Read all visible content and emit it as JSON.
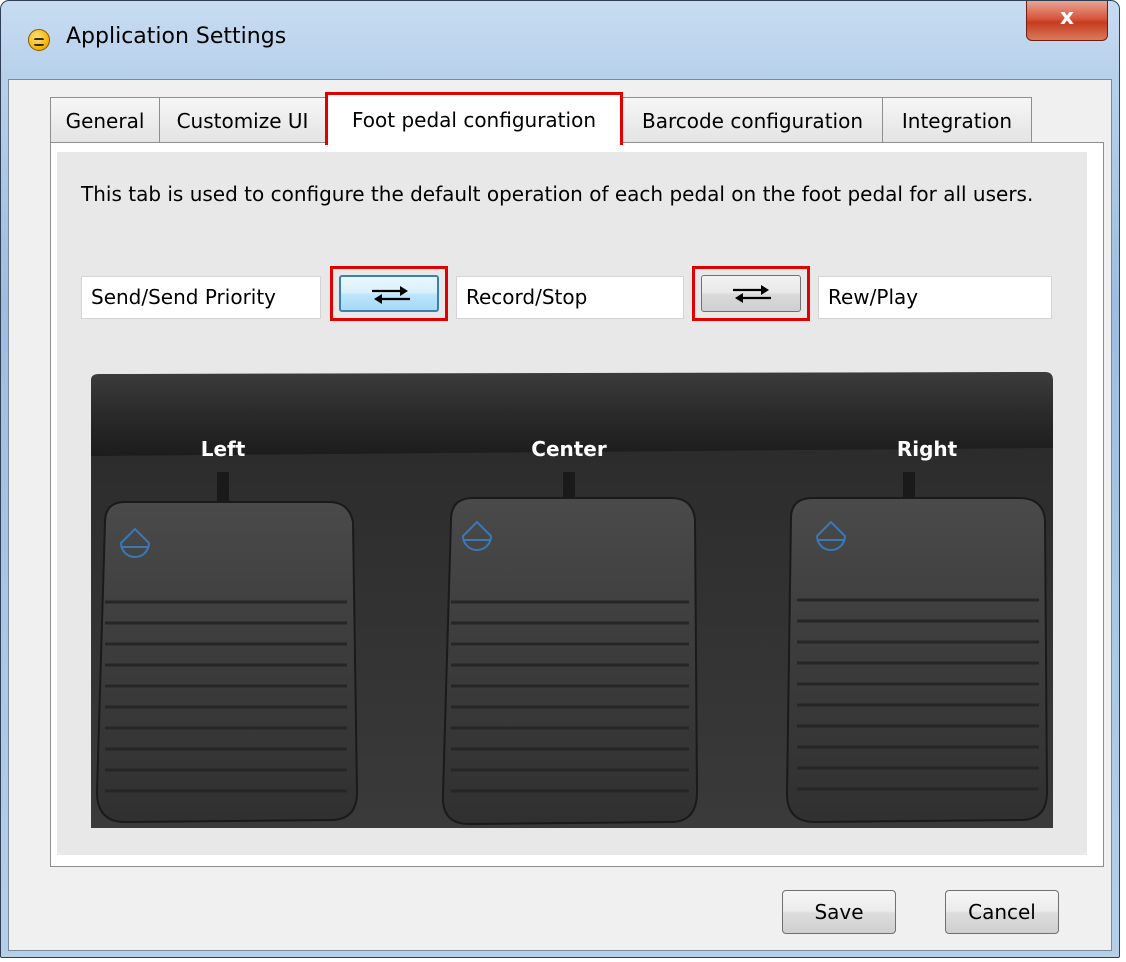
{
  "window": {
    "title": "Application Settings",
    "close_glyph": "x"
  },
  "tabs": [
    {
      "label": "General",
      "active": false
    },
    {
      "label": "Customize UI",
      "active": false
    },
    {
      "label": "Foot pedal configuration",
      "active": true
    },
    {
      "label": "Barcode configuration",
      "active": false
    },
    {
      "label": "Integration",
      "active": false
    }
  ],
  "foot_pedal": {
    "description": "This tab is used to configure the default operation of each pedal on the foot pedal for all users.",
    "fields": {
      "left": "Send/Send Priority",
      "center": "Record/Stop",
      "right": "Rew/Play"
    },
    "swap_icon": "swap-arrows-icon",
    "pedal_labels": {
      "left": "Left",
      "center": "Center",
      "right": "Right"
    }
  },
  "footer": {
    "save_label": "Save",
    "cancel_label": "Cancel"
  },
  "colors": {
    "highlight": "#e00000",
    "pedal_icon": "#3a78b8"
  }
}
